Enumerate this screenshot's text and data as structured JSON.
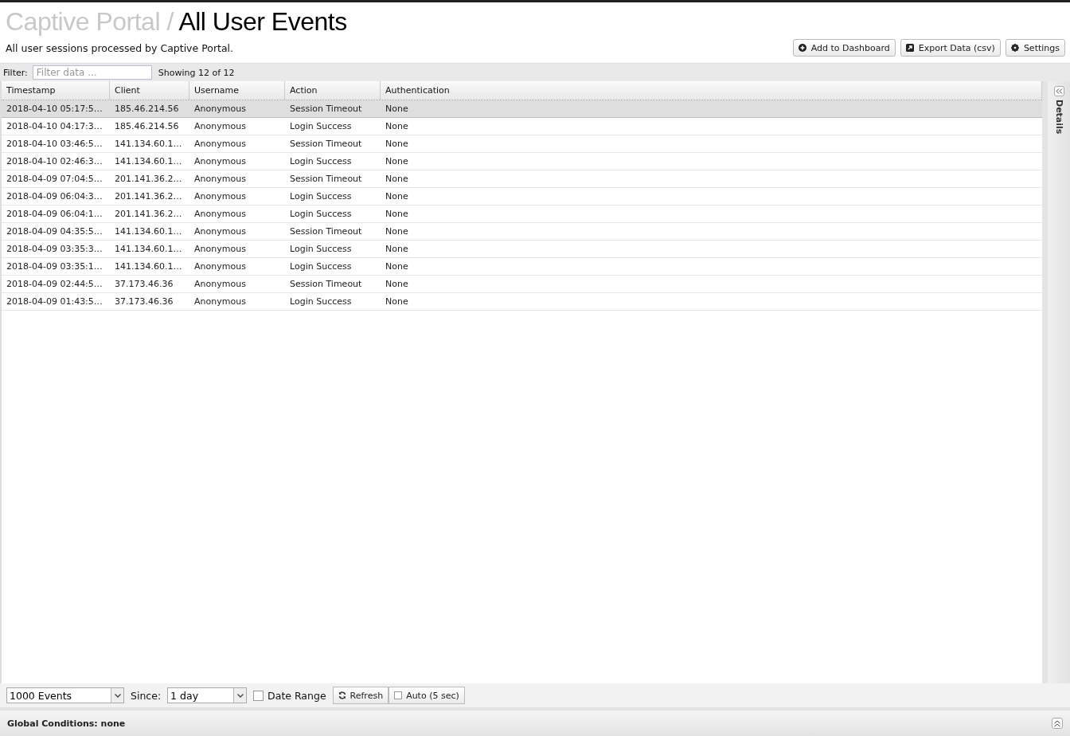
{
  "title": {
    "parent": "Captive Portal /",
    "current": "All User Events"
  },
  "description": "All user sessions processed by Captive Portal.",
  "actions": [
    {
      "label": "Add to Dashboard",
      "kind": "add"
    },
    {
      "label": "Export Data (csv)",
      "kind": "export"
    },
    {
      "label": "Settings",
      "kind": "settings"
    }
  ],
  "filter": {
    "label": "Filter:",
    "placeholder": "Filter data ...",
    "count": "Showing 12 of 12"
  },
  "table": {
    "columns": [
      "Timestamp",
      "Client",
      "Username",
      "Action",
      "Authentication"
    ],
    "rows": [
      {
        "selected": true,
        "cells": [
          "2018-04-10 05:17:5…",
          "185.46.214.56",
          "Anonymous",
          "Session Timeout",
          "None"
        ]
      },
      {
        "selected": false,
        "cells": [
          "2018-04-10 04:17:3…",
          "185.46.214.56",
          "Anonymous",
          "Login Success",
          "None"
        ]
      },
      {
        "selected": false,
        "cells": [
          "2018-04-10 03:46:5…",
          "141.134.60.1…",
          "Anonymous",
          "Session Timeout",
          "None"
        ]
      },
      {
        "selected": false,
        "cells": [
          "2018-04-10 02:46:3…",
          "141.134.60.1…",
          "Anonymous",
          "Login Success",
          "None"
        ]
      },
      {
        "selected": false,
        "cells": [
          "2018-04-09 07:04:5…",
          "201.141.36.2…",
          "Anonymous",
          "Session Timeout",
          "None"
        ]
      },
      {
        "selected": false,
        "cells": [
          "2018-04-09 06:04:3…",
          "201.141.36.2…",
          "Anonymous",
          "Login Success",
          "None"
        ]
      },
      {
        "selected": false,
        "cells": [
          "2018-04-09 06:04:1…",
          "201.141.36.2…",
          "Anonymous",
          "Login Success",
          "None"
        ]
      },
      {
        "selected": false,
        "cells": [
          "2018-04-09 04:35:5…",
          "141.134.60.1…",
          "Anonymous",
          "Session Timeout",
          "None"
        ]
      },
      {
        "selected": false,
        "cells": [
          "2018-04-09 03:35:3…",
          "141.134.60.1…",
          "Anonymous",
          "Login Success",
          "None"
        ]
      },
      {
        "selected": false,
        "cells": [
          "2018-04-09 03:35:1…",
          "141.134.60.1…",
          "Anonymous",
          "Login Success",
          "None"
        ]
      },
      {
        "selected": false,
        "cells": [
          "2018-04-09 02:44:5…",
          "37.173.46.36",
          "Anonymous",
          "Session Timeout",
          "None"
        ]
      },
      {
        "selected": false,
        "cells": [
          "2018-04-09 01:43:5…",
          "37.173.46.36",
          "Anonymous",
          "Login Success",
          "None"
        ]
      }
    ]
  },
  "details_panel": {
    "label": "Details"
  },
  "toolbar": {
    "limit": "1000 Events",
    "since_label": "Since:",
    "since": "1 day",
    "date_range": {
      "label": "Date Range",
      "checked": false
    },
    "refresh": "Refresh",
    "auto": {
      "label": "Auto (5 sec)",
      "checked": false
    }
  },
  "global_conditions": "Global Conditions: none"
}
